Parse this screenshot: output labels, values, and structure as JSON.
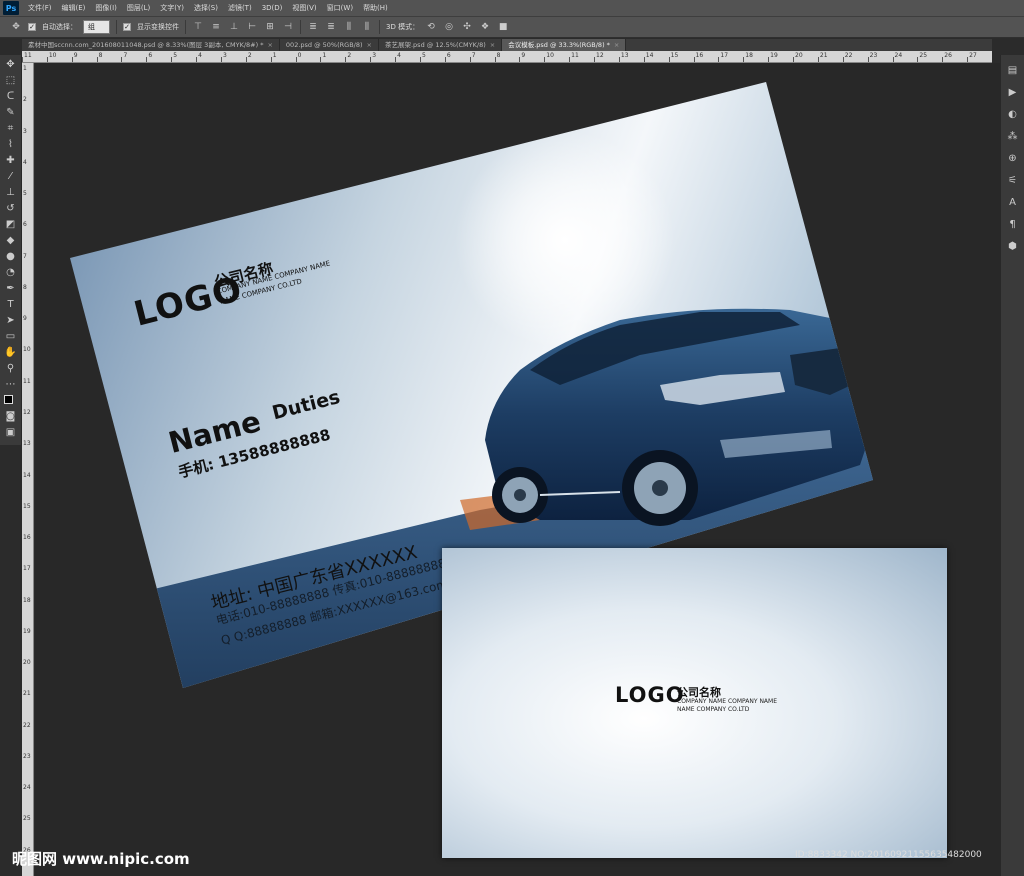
{
  "app": {
    "logo": "Ps"
  },
  "menu": [
    "文件(F)",
    "编辑(E)",
    "图像(I)",
    "图层(L)",
    "文字(Y)",
    "选择(S)",
    "滤镜(T)",
    "3D(D)",
    "视图(V)",
    "窗口(W)",
    "帮助(H)"
  ],
  "options": {
    "auto_select_label": "自动选择：",
    "auto_select_value": "组",
    "show_transform_label": "显示变换控件",
    "mode_3d_label": "3D 模式："
  },
  "tabs": [
    {
      "label": "素材中国sccnn.com_20160801104​8.psd @ 8.33%(图层 3副本, CMYK/8#) *",
      "active": false
    },
    {
      "label": "002.psd @ 50%(RGB/8)",
      "active": false
    },
    {
      "label": "茶艺展架.psd @ 12.5%(CMYK/8)",
      "active": false
    },
    {
      "label": "会议模板.psd @ 33.3%(RGB/8) *",
      "active": true
    }
  ],
  "ruler_top": [
    "11",
    "10",
    "9",
    "8",
    "7",
    "6",
    "5",
    "4",
    "3",
    "2",
    "1",
    "0",
    "1",
    "2",
    "3",
    "4",
    "5",
    "6",
    "7",
    "8",
    "9",
    "10",
    "11",
    "12",
    "13",
    "14",
    "15",
    "16",
    "17",
    "18",
    "19",
    "20",
    "21",
    "22",
    "23",
    "24",
    "25",
    "26",
    "27"
  ],
  "ruler_left": [
    "1",
    "2",
    "3",
    "4",
    "5",
    "6",
    "7",
    "8",
    "9",
    "10",
    "11",
    "12",
    "13",
    "14",
    "15",
    "16",
    "17",
    "18",
    "19",
    "20",
    "21",
    "22",
    "23",
    "24",
    "25",
    "26"
  ],
  "card_front": {
    "logo": "LOGO",
    "company_name": "公司名称",
    "company_sub1": "COMPANY NAME COMPANY NAME",
    "company_sub2": "NAME COMPANY CO.LTD",
    "name": "Name",
    "duties": "Duties",
    "phone": "手机:  13588888888",
    "address": "地址:  中国广东省XXXXXX",
    "tel": "电话:010-88888888  传真:010-88888888",
    "qq": "Q Q:88888888   邮箱:XXXXXX@163.com"
  },
  "card_back": {
    "logo": "LOGO",
    "company_name": "公司名称",
    "company_sub1": "COMPANY NAME COMPANY NAME",
    "company_sub2": "NAME COMPANY CO.LTD"
  },
  "watermark": "昵图网 www.nipic.com",
  "image_id": "ID:8833342 NO:20160921155635482000",
  "colors": {
    "car_body": "#1d3d63",
    "ui_panel": "#535353",
    "canvas_bg": "#282828"
  }
}
